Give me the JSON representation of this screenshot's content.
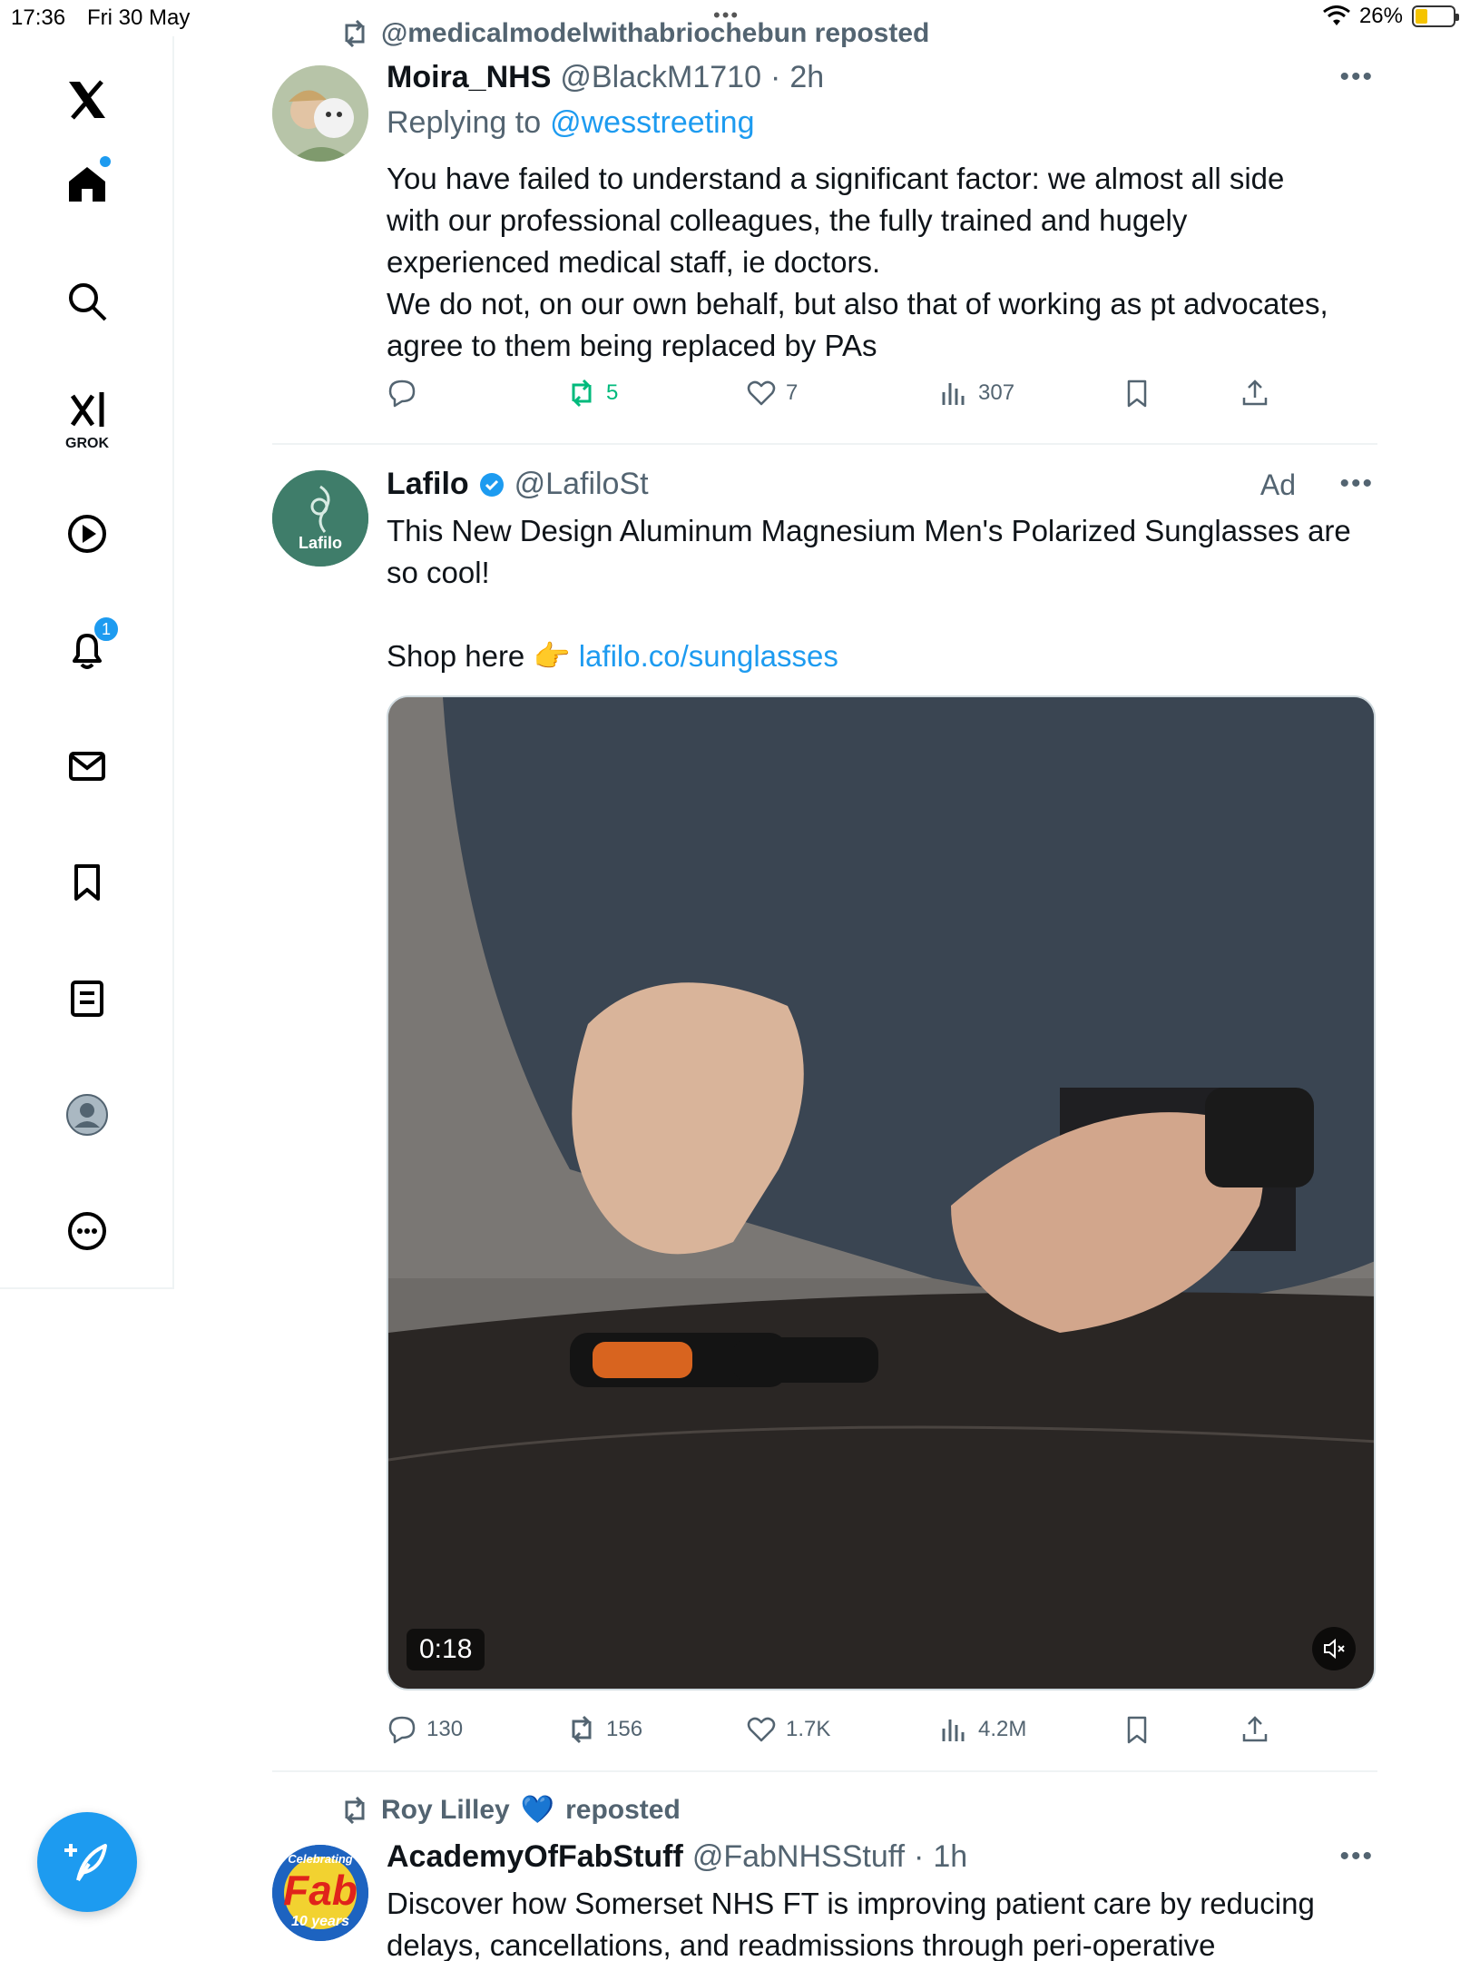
{
  "status_bar": {
    "time": "17:36",
    "date": "Fri 30 May",
    "battery": "26%"
  },
  "sidebar": {
    "grok_label": "GROK",
    "notifications_count": "1"
  },
  "tweets": [
    {
      "repost_by": "@medicalmodelwithabriochebun reposted",
      "name": "Moira_NHS",
      "handle": "@BlackM1710",
      "sep": "·",
      "time": "2h",
      "replying_prefix": "Replying to",
      "replying_to": "@wesstreeting",
      "text_lines": [
        "You have failed to understand a significant factor: we almost all side",
        "with our professional colleagues, the fully trained and hugely",
        "experienced medical staff, ie doctors.",
        "We do not, on our own behalf, but also that of working as pt advocates,",
        "agree to them being replaced by PAs"
      ],
      "retweets": "5",
      "likes": "7",
      "views": "307"
    },
    {
      "name": "Lafilo",
      "handle": "@LafiloSt",
      "ad_label": "Ad",
      "avatar_text": "Lafilo",
      "text_line1": "This New Design Aluminum Magnesium Men's Polarized Sunglasses are",
      "text_line2": "so cool!",
      "shop_prefix": "Shop here 👉",
      "link": "lafilo.co/sunglasses",
      "video_duration": "0:18",
      "replies": "130",
      "retweets": "156",
      "likes": "1.7K",
      "views": "4.2M"
    },
    {
      "repost_by": "Roy Lilley",
      "repost_heart": "💙",
      "repost_suffix": "reposted",
      "name": "AcademyOfFabStuff",
      "handle": "@FabNHSStuff",
      "sep": "·",
      "time": "1h",
      "avatar_top": "Celebrating",
      "avatar_mid": "Fab",
      "avatar_bottom": "10 years",
      "text_line1": "Discover how Somerset NHS FT is improving patient care by reducing",
      "text_line2": "delays, cancellations, and readmissions through peri-operative"
    }
  ],
  "colors": {
    "accent": "#1d9bf0",
    "retweet_active": "#00ba7c",
    "muted_text": "#536471"
  }
}
